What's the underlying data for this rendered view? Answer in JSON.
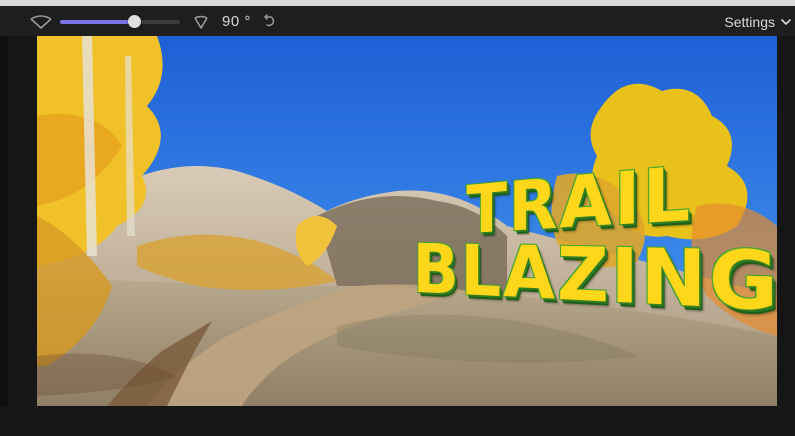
{
  "toolbar": {
    "angle_value": "90 °",
    "settings_label": "Settings",
    "field_of_view_level": 0.62
  },
  "viewer": {
    "title_line1": "TRAIL",
    "title_line2": "BLAZING"
  },
  "colors": {
    "accent": "#7a73e5",
    "title_fill": "#ffd71a",
    "title_outline": "#3aa32c"
  }
}
